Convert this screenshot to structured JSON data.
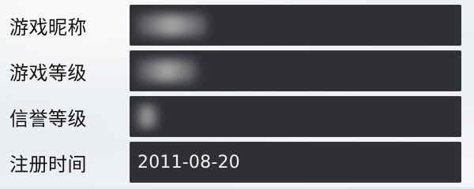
{
  "rows": [
    {
      "label": "游戏昵称",
      "value": ""
    },
    {
      "label": "游戏等级",
      "value": ""
    },
    {
      "label": "信誉等级",
      "value": ""
    },
    {
      "label": "注册时间",
      "value": "2011-08-20"
    }
  ],
  "colors": {
    "field_bg": "#2f3034",
    "field_text": "#f2f2f2",
    "label_text": "#111111",
    "page_bg": "#e9ecef"
  }
}
